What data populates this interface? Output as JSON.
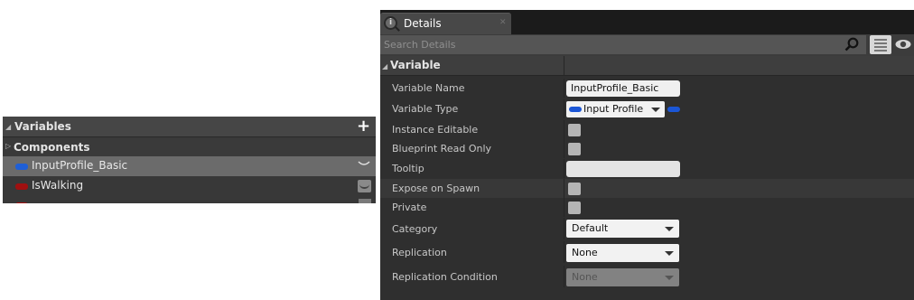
{
  "variables_panel": {
    "title": "Variables",
    "add_icon": "plus-icon",
    "components_label": "Components",
    "items": [
      {
        "name": "InputProfile_Basic",
        "color": "#1f5fd6",
        "selected": true
      },
      {
        "name": "IsWalking",
        "color": "#a01010",
        "selected": false
      }
    ]
  },
  "details": {
    "tab_label": "Details",
    "tab_icon": "details-icon",
    "search_placeholder": "Search Details",
    "category_title": "Variable",
    "properties": {
      "variable_name": {
        "label": "Variable Name",
        "value": "InputProfile_Basic"
      },
      "variable_type": {
        "label": "Variable Type",
        "value": "Input Profile",
        "color": "#1b56d6"
      },
      "instance_editable": {
        "label": "Instance Editable",
        "checked": false
      },
      "blueprint_read_only": {
        "label": "Blueprint Read Only",
        "checked": false
      },
      "tooltip": {
        "label": "Tooltip",
        "value": ""
      },
      "expose_on_spawn": {
        "label": "Expose on Spawn",
        "checked": false
      },
      "private": {
        "label": "Private",
        "checked": false
      },
      "category": {
        "label": "Category",
        "value": "Default"
      },
      "replication": {
        "label": "Replication",
        "value": "None"
      },
      "replication_condition": {
        "label": "Replication Condition",
        "value": "None",
        "enabled": false
      }
    }
  }
}
